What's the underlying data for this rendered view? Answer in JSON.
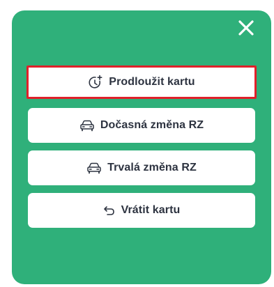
{
  "dialog": {
    "close_icon": "close-icon",
    "buttons": [
      {
        "label": "Prodloužit kartu",
        "icon": "clock-plus-icon"
      },
      {
        "label": "Dočasná změna RZ",
        "icon": "car-icon"
      },
      {
        "label": "Trvalá změna RZ",
        "icon": "car-icon"
      },
      {
        "label": "Vrátit kartu",
        "icon": "undo-icon"
      }
    ]
  },
  "colors": {
    "panel_bg": "#2fb07a",
    "button_bg": "#ffffff",
    "highlight_border": "#e0202a",
    "text": "#2d3340"
  }
}
